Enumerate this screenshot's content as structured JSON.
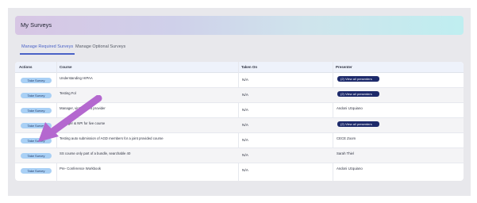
{
  "header": {
    "title": "My Surveys"
  },
  "tabs": [
    {
      "label": "Manage Required Surveys",
      "active": true
    },
    {
      "label": "Manage Optional Surveys",
      "active": false
    }
  ],
  "table": {
    "columns": [
      "Actions",
      "Course",
      "Taken On",
      "Presenter"
    ],
    "rows": [
      {
        "action": "Take Survey",
        "course": "Understanding HIPAA",
        "taken_on": "N/A",
        "presenter": "",
        "presenter_button": "(2) View all presenters"
      },
      {
        "action": "Take Survey",
        "course": "Testing Fol",
        "taken_on": "N/A",
        "presenter": "",
        "presenter_button": "(2) View all presenters"
      },
      {
        "action": "Take Survey",
        "course": "Manager, vinSal Joint provider",
        "taken_on": "N/A",
        "presenter": "Andoni Uzquiano",
        "presenter_button": ""
      },
      {
        "action": "Take Survey",
        "course": "Manager & NPI for live course",
        "taken_on": "N/A",
        "presenter": "",
        "presenter_button": "(2) View all presenters"
      },
      {
        "action": "Take Survey",
        "course": "Testing auto submission of AGD members for a joint provided course",
        "taken_on": "N/A",
        "presenter": "CECE Zoom",
        "presenter_button": ""
      },
      {
        "action": "Take Survey",
        "course": "SS course only part of a bundle, searchable 40",
        "taken_on": "N/A",
        "presenter": "Sarah Thiel",
        "presenter_button": ""
      },
      {
        "action": "Take Survey",
        "course": "Pre- Conference Workbook",
        "taken_on": "N/A",
        "presenter": "Andoni Uzquiano",
        "presenter_button": ""
      }
    ]
  },
  "colors": {
    "accent": "#4a62c7",
    "take_button_bg": "#a9d0f5",
    "presenter_button_bg": "#1d2a6b",
    "annotation_arrow": "#b468cf"
  },
  "icons": {
    "annotation": "arrow-annotation-icon"
  }
}
